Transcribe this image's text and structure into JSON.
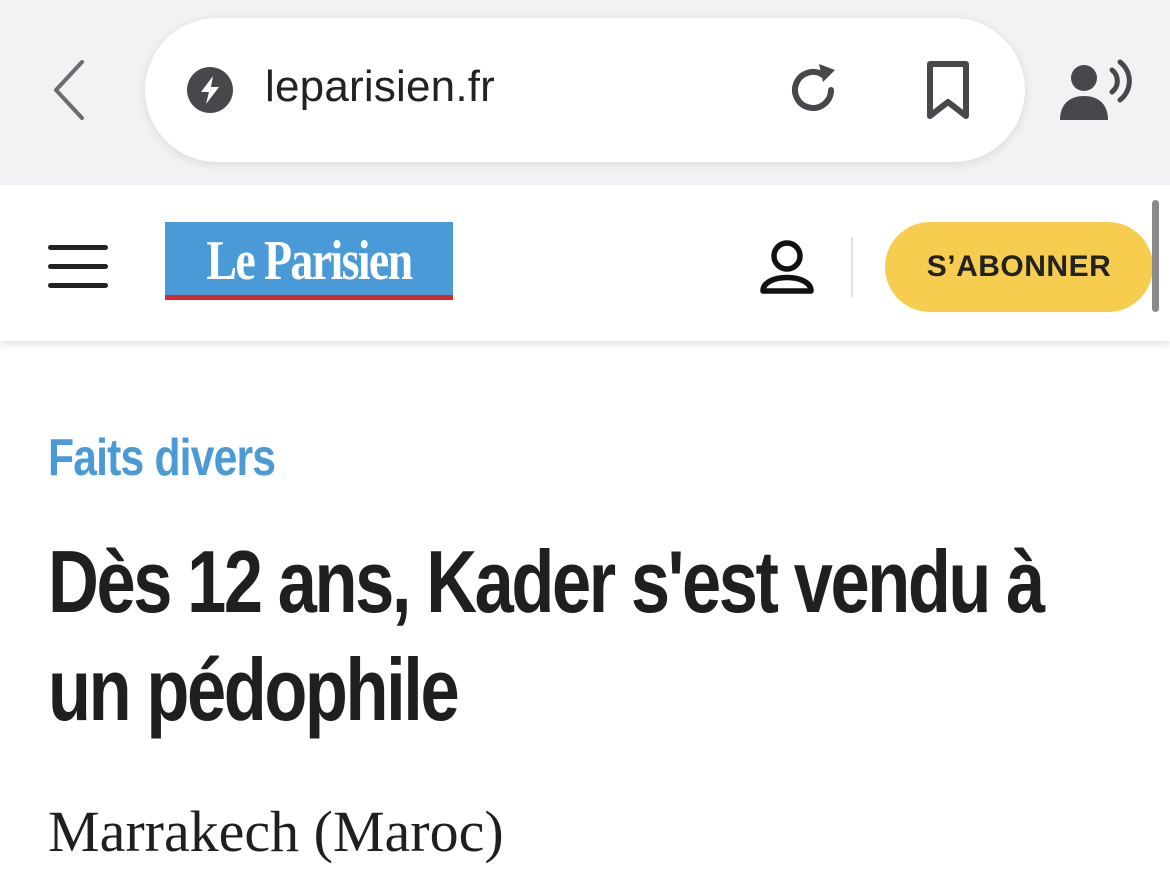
{
  "browser": {
    "url": "leparisien.fr",
    "icons": {
      "back": "chevron-left-icon",
      "site": "bolt-icon",
      "reload": "reload-icon",
      "bookmark": "bookmark-icon",
      "reader": "speaking-person-icon"
    }
  },
  "header": {
    "logo_text": "Le Parisien",
    "subscribe_label": "S’ABONNER",
    "colors": {
      "logo_blue": "#4a9ad8",
      "logo_stripe": "#d6282b",
      "subscribe_bg": "#f6cd4f"
    }
  },
  "article": {
    "section": "Faits divers",
    "headline": "Dès 12 ans, Kader s'est vendu à un pédophile",
    "dateline": "Marrakech (Maroc)"
  }
}
